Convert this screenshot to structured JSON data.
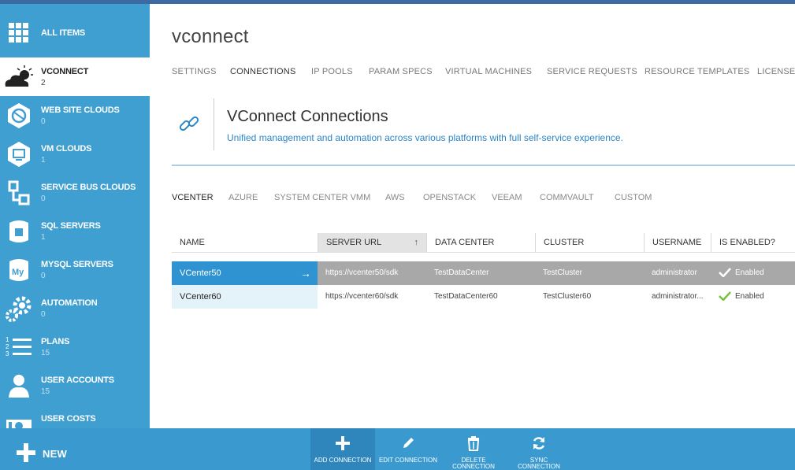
{
  "sidebar": {
    "items": [
      {
        "label": "ALL ITEMS",
        "count": "",
        "icon": "grid-icon"
      },
      {
        "label": "VCONNECT",
        "count": "2",
        "icon": "cloud-sun-icon"
      },
      {
        "label": "WEB SITE CLOUDS",
        "count": "0",
        "icon": "globe-icon"
      },
      {
        "label": "VM CLOUDS",
        "count": "1",
        "icon": "monitor-icon"
      },
      {
        "label": "SERVICE BUS CLOUDS",
        "count": "0",
        "icon": "service-bus-icon"
      },
      {
        "label": "SQL SERVERS",
        "count": "1",
        "icon": "sql-icon"
      },
      {
        "label": "MYSQL SERVERS",
        "count": "0",
        "icon": "mysql-icon"
      },
      {
        "label": "AUTOMATION",
        "count": "0",
        "icon": "gears-icon"
      },
      {
        "label": "PLANS",
        "count": "15",
        "icon": "list-icon"
      },
      {
        "label": "USER ACCOUNTS",
        "count": "15",
        "icon": "user-icon"
      },
      {
        "label": "USER COSTS",
        "count": "",
        "icon": "money-icon"
      }
    ]
  },
  "page": {
    "title": "vconnect"
  },
  "tabs": [
    "SETTINGS",
    "CONNECTIONS",
    "IP POOLS",
    "PARAM SPECS",
    "VIRTUAL MACHINES",
    "SERVICE REQUESTS",
    "RESOURCE TEMPLATES",
    "LICENSE"
  ],
  "active_tab": "CONNECTIONS",
  "hero": {
    "title": "VConnect Connections",
    "subtitle": "Unified management and automation across various platforms with full self-service experience."
  },
  "subtabs": [
    "VCENTER",
    "AZURE",
    "SYSTEM CENTER VMM",
    "AWS",
    "OPENSTACK",
    "VEEAM",
    "COMMVAULT",
    "CUSTOM"
  ],
  "active_subtab": "VCENTER",
  "table": {
    "headers": [
      "NAME",
      "SERVER URL",
      "DATA CENTER",
      "CLUSTER",
      "USERNAME",
      "IS ENABLED?"
    ],
    "sort_arrow": "↑",
    "rows": [
      {
        "name": "VCenter50",
        "url": "https://vcenter50/sdk",
        "datacenter": "TestDataCenter",
        "cluster": "TestCluster",
        "username": "administrator",
        "enabled": "Enabled"
      },
      {
        "name": "VCenter60",
        "url": "https://vcenter60/sdk",
        "datacenter": "TestDataCenter60",
        "cluster": "TestCluster60",
        "username": "administrator...",
        "enabled": "Enabled"
      }
    ]
  },
  "bottom": {
    "new_label": "NEW",
    "commands": [
      {
        "label": "ADD CONNECTION",
        "icon": "plus-icon"
      },
      {
        "label": "EDIT CONNECTION",
        "icon": "pencil-icon"
      },
      {
        "label": "DELETE CONNECTION",
        "icon": "trash-icon"
      },
      {
        "label": "SYNC CONNECTION",
        "icon": "sync-icon"
      }
    ]
  },
  "colors": {
    "sidebar": "#3f9fd1",
    "accent": "#2f93d1",
    "selected_row": "#a8a8a8",
    "check": "#7ac142"
  }
}
